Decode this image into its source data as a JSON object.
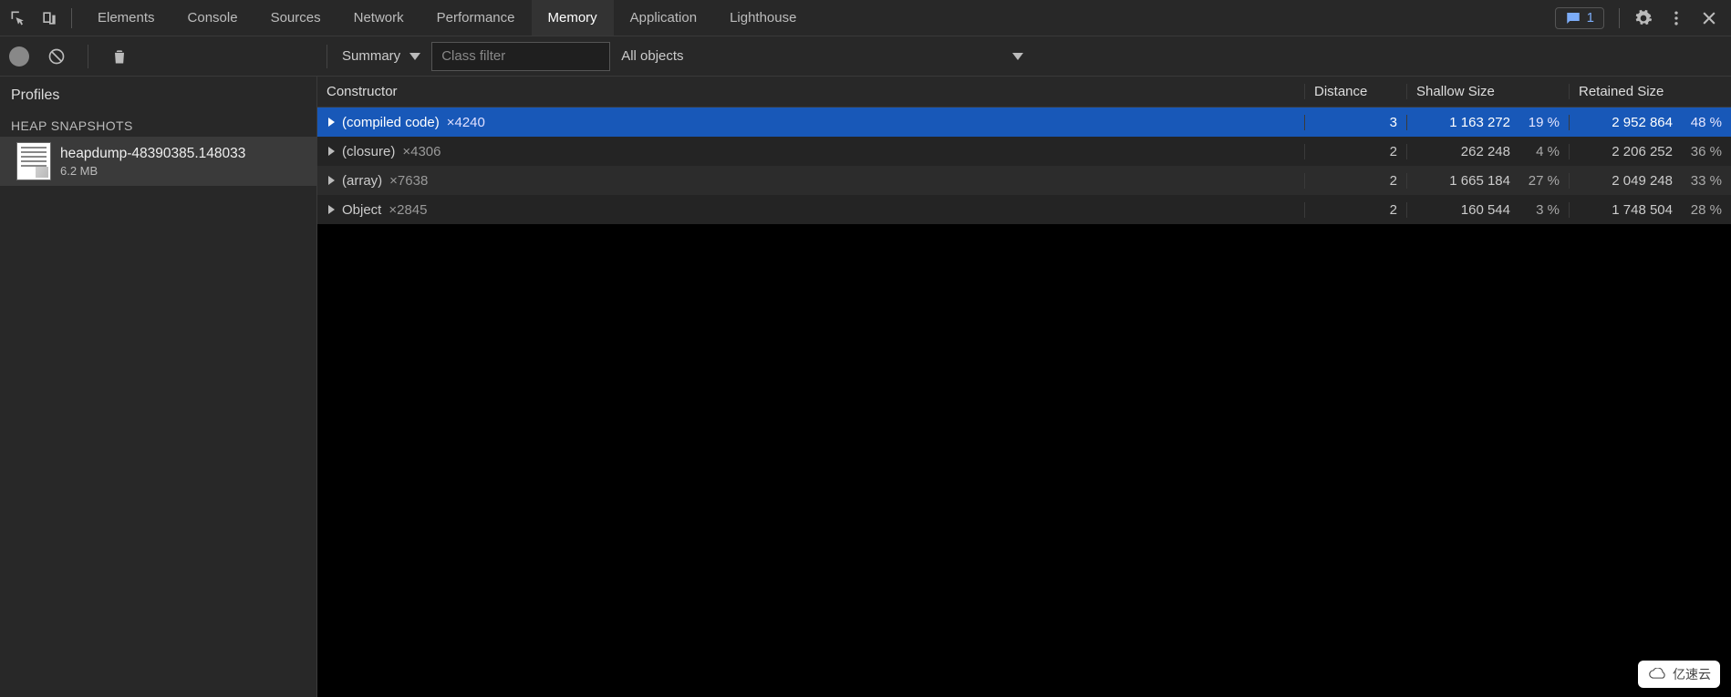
{
  "tabs": {
    "items": [
      "Elements",
      "Console",
      "Sources",
      "Network",
      "Performance",
      "Memory",
      "Application",
      "Lighthouse"
    ],
    "active": "Memory"
  },
  "msg_count": "1",
  "toolbar": {
    "summary_label": "Summary",
    "filter_placeholder": "Class filter",
    "scope_label": "All objects"
  },
  "sidebar": {
    "profiles_label": "Profiles",
    "section_header": "HEAP SNAPSHOTS",
    "snapshot": {
      "name": "heapdump-48390385.148033",
      "size": "6.2 MB"
    }
  },
  "columns": {
    "constructor": "Constructor",
    "distance": "Distance",
    "shallow": "Shallow Size",
    "retained": "Retained Size"
  },
  "rows": [
    {
      "name": "(compiled code)",
      "count": "×4240",
      "distance": "3",
      "shallow": "1 163 272",
      "shallow_pct": "19 %",
      "retained": "2 952 864",
      "retained_pct": "48 %",
      "selected": true
    },
    {
      "name": "(closure)",
      "count": "×4306",
      "distance": "2",
      "shallow": "262 248",
      "shallow_pct": "4 %",
      "retained": "2 206 252",
      "retained_pct": "36 %",
      "selected": false
    },
    {
      "name": "(array)",
      "count": "×7638",
      "distance": "2",
      "shallow": "1 665 184",
      "shallow_pct": "27 %",
      "retained": "2 049 248",
      "retained_pct": "33 %",
      "selected": false
    },
    {
      "name": "Object",
      "count": "×2845",
      "distance": "2",
      "shallow": "160 544",
      "shallow_pct": "3 %",
      "retained": "1 748 504",
      "retained_pct": "28 %",
      "selected": false
    }
  ],
  "watermark": "亿速云"
}
